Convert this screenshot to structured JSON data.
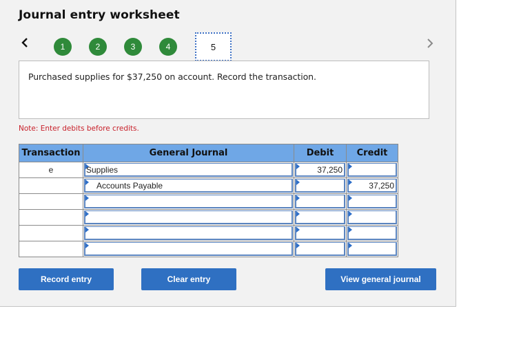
{
  "header": {
    "title": "Journal entry worksheet"
  },
  "navigation": {
    "prev_icon": "chevron-left-icon",
    "next_icon": "chevron-right-icon",
    "steps": [
      {
        "label": "1",
        "state": "complete"
      },
      {
        "label": "2",
        "state": "complete"
      },
      {
        "label": "3",
        "state": "complete"
      },
      {
        "label": "4",
        "state": "complete"
      },
      {
        "label": "5",
        "state": "active"
      }
    ],
    "complete_color": "#2f8a3a"
  },
  "prompt": {
    "text": "Purchased supplies for $37,250 on account. Record the transaction."
  },
  "note": {
    "text": "Note: Enter debits before credits.",
    "color": "#c8202a"
  },
  "journal": {
    "headers": {
      "transaction": "Transaction",
      "general_journal": "General Journal",
      "debit": "Debit",
      "credit": "Credit"
    },
    "header_color": "#6fa7e6",
    "rows": [
      {
        "transaction": "e",
        "account": "Supplies",
        "indent": false,
        "debit": "37,250",
        "credit": ""
      },
      {
        "transaction": "",
        "account": "Accounts Payable",
        "indent": true,
        "debit": "",
        "credit": "37,250"
      },
      {
        "transaction": "",
        "account": "",
        "indent": false,
        "debit": "",
        "credit": ""
      },
      {
        "transaction": "",
        "account": "",
        "indent": false,
        "debit": "",
        "credit": ""
      },
      {
        "transaction": "",
        "account": "",
        "indent": false,
        "debit": "",
        "credit": ""
      },
      {
        "transaction": "",
        "account": "",
        "indent": false,
        "debit": "",
        "credit": ""
      }
    ]
  },
  "buttons": {
    "record_entry": "Record entry",
    "clear_entry": "Clear entry",
    "view_general_journal": "View general journal",
    "color": "#2f70c2"
  }
}
